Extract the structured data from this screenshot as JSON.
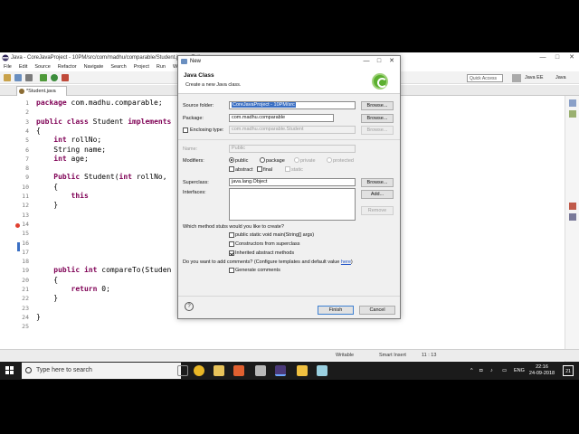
{
  "window": {
    "title": "Java - CoreJavaProject - 10PM/src/com/madhu/comparable/Student.java - Eclipse",
    "controls": {
      "minimize": "—",
      "maximize": "□",
      "close": "✕"
    }
  },
  "menu": [
    "File",
    "Edit",
    "Source",
    "Refactor",
    "Navigate",
    "Search",
    "Project",
    "Run",
    "Window"
  ],
  "toolbar": {
    "quick_access": "Quick Access",
    "perspective_java_ee": "Java EE",
    "perspective_java": "Java"
  },
  "editor": {
    "tab_label": "*Student.java",
    "lines": [
      {
        "num": "1",
        "segments": [
          {
            "t": "package",
            "kw": true
          },
          {
            "t": " com.madhu.comparable;"
          }
        ]
      },
      {
        "num": "2",
        "segments": []
      },
      {
        "num": "3",
        "segments": [
          {
            "t": "public",
            "kw": true
          },
          {
            "t": " "
          },
          {
            "t": "class",
            "kw": true
          },
          {
            "t": " Student "
          },
          {
            "t": "implements",
            "kw": true
          }
        ]
      },
      {
        "num": "4",
        "segments": [
          {
            "t": "{"
          }
        ]
      },
      {
        "num": "5",
        "segments": [
          {
            "t": "    "
          },
          {
            "t": "int",
            "kw": true
          },
          {
            "t": " rollNo;"
          }
        ]
      },
      {
        "num": "6",
        "segments": [
          {
            "t": "    String name;"
          }
        ]
      },
      {
        "num": "7",
        "segments": [
          {
            "t": "    "
          },
          {
            "t": "int",
            "kw": true
          },
          {
            "t": " age;"
          }
        ]
      },
      {
        "num": "8",
        "segments": []
      },
      {
        "num": "9",
        "segments": [
          {
            "t": "    "
          },
          {
            "t": "Public",
            "kw": true
          },
          {
            "t": " Student("
          },
          {
            "t": "int",
            "kw": true
          },
          {
            "t": " rollNo,"
          }
        ]
      },
      {
        "num": "10",
        "segments": [
          {
            "t": "    {"
          }
        ]
      },
      {
        "num": "11",
        "segments": [
          {
            "t": "        "
          },
          {
            "t": "this",
            "kw": true
          }
        ]
      },
      {
        "num": "12",
        "segments": [
          {
            "t": "    }"
          }
        ]
      },
      {
        "num": "13",
        "segments": []
      },
      {
        "num": "14",
        "segments": []
      },
      {
        "num": "15",
        "segments": []
      },
      {
        "num": "16",
        "segments": []
      },
      {
        "num": "17",
        "segments": []
      },
      {
        "num": "18",
        "segments": []
      },
      {
        "num": "19",
        "segments": [
          {
            "t": "    "
          },
          {
            "t": "public",
            "kw": true
          },
          {
            "t": " "
          },
          {
            "t": "int",
            "kw": true
          },
          {
            "t": " compareTo(Studen"
          }
        ]
      },
      {
        "num": "20",
        "segments": [
          {
            "t": "    {"
          }
        ]
      },
      {
        "num": "21",
        "segments": [
          {
            "t": "        "
          },
          {
            "t": "return",
            "kw": true
          },
          {
            "t": " 0;"
          }
        ]
      },
      {
        "num": "22",
        "segments": [
          {
            "t": "    }"
          }
        ]
      },
      {
        "num": "23",
        "segments": []
      },
      {
        "num": "24",
        "segments": [
          {
            "t": "}"
          }
        ]
      },
      {
        "num": "25",
        "segments": []
      }
    ]
  },
  "status": {
    "writable": "Writable",
    "insert_mode": "Smart Insert",
    "position": "11 : 13"
  },
  "dialog": {
    "title": "New",
    "header_title": "Java Class",
    "header_desc": "Create a new Java class.",
    "source_folder_label": "Source folder:",
    "source_folder_value": "CoreJavaProject - 10PM/src",
    "package_label": "Package:",
    "package_value": "com.madhu.comparable",
    "enclosing_type_label": "Enclosing type:",
    "enclosing_type_value": "com.madhu.comparable.Student",
    "name_label": "Name:",
    "name_value": "Public",
    "modifiers_label": "Modifiers:",
    "mod_public": "public",
    "mod_package": "package",
    "mod_private": "private",
    "mod_protected": "protected",
    "mod_abstract": "abstract",
    "mod_final": "final",
    "mod_static": "static",
    "superclass_label": "Superclass:",
    "superclass_value": "java.lang.Object",
    "interfaces_label": "Interfaces:",
    "browse": "Browse...",
    "add": "Add...",
    "remove": "Remove",
    "stubs_question": "Which method stubs would you like to create?",
    "stub_main": "public static void main(String[] args)",
    "stub_constructors": "Constructors from superclass",
    "stub_inherited": "Inherited abstract methods",
    "comments_question": "Do you want to add comments? (Configure templates and default value",
    "comments_link": "here",
    "comments_close": ")",
    "generate_comments": "Generate comments",
    "help": "?",
    "finish": "Finish",
    "cancel": "Cancel"
  },
  "taskbar": {
    "search_placeholder": "Type here to search",
    "language": "ENG",
    "time": "22:16",
    "date": "24-09-2018",
    "notifications": "21"
  },
  "colors": {
    "keyword": "#7f0055",
    "selection": "#3a6fc4",
    "taskbar": "#1b1b1b"
  }
}
